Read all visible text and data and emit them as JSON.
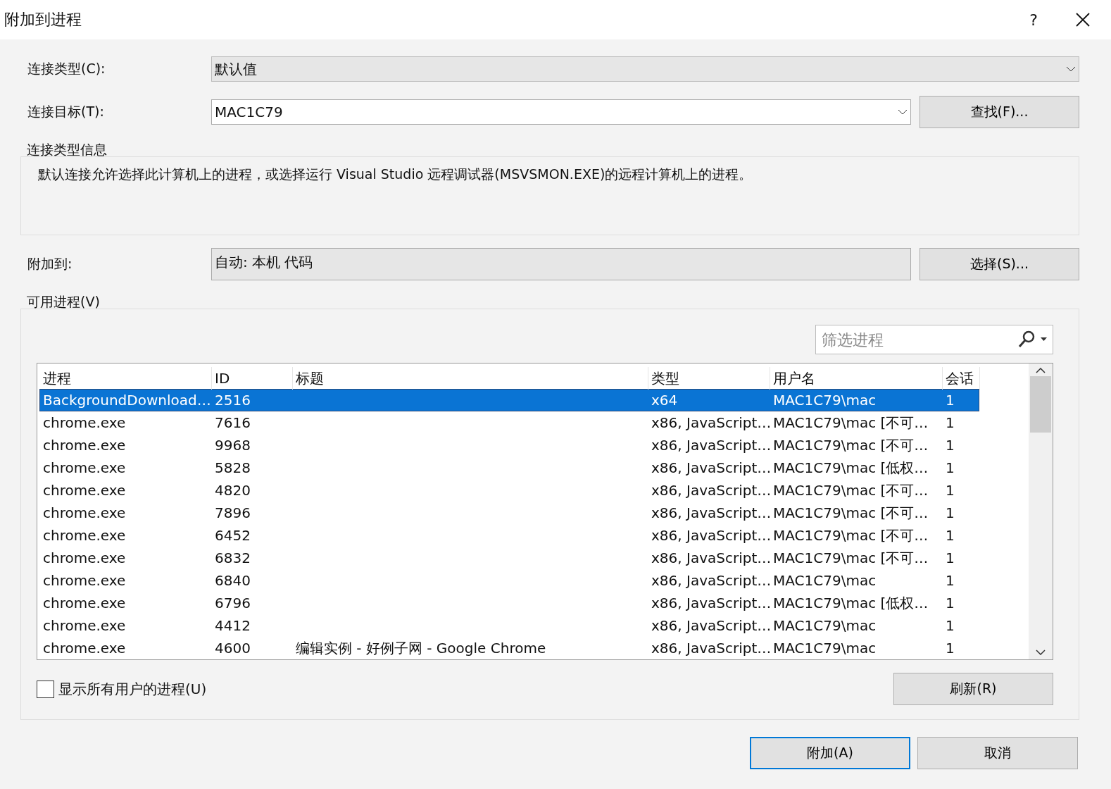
{
  "window": {
    "title": "附加到进程",
    "help": "?"
  },
  "connection_type": {
    "label": "连接类型(C):",
    "value": "默认值"
  },
  "connection_target": {
    "label": "连接目标(T):",
    "value": "MAC1C79",
    "button": "查找(F)..."
  },
  "info": {
    "heading": "连接类型信息",
    "text": "默认连接允许选择此计算机上的进程，或选择运行 Visual Studio 远程调试器(MSVSMON.EXE)的远程计算机上的进程。"
  },
  "attach_to": {
    "label": "附加到:",
    "value": "自动: 本机 代码",
    "button": "选择(S)..."
  },
  "processes": {
    "heading": "可用进程(V)",
    "filter": {
      "placeholder": "筛选进程"
    },
    "columns": [
      "进程",
      "ID",
      "标题",
      "类型",
      "用户名",
      "会话"
    ],
    "rows": [
      {
        "cells": [
          "BackgroundDownload…",
          "2516",
          "",
          "x64",
          "MAC1C79\\mac",
          "1"
        ],
        "selected": true
      },
      {
        "cells": [
          "chrome.exe",
          "7616",
          "",
          "x86, JavaScript…",
          "MAC1C79\\mac [不可…",
          "1"
        ],
        "selected": false
      },
      {
        "cells": [
          "chrome.exe",
          "9968",
          "",
          "x86, JavaScript…",
          "MAC1C79\\mac [不可…",
          "1"
        ],
        "selected": false
      },
      {
        "cells": [
          "chrome.exe",
          "5828",
          "",
          "x86, JavaScript…",
          "MAC1C79\\mac [低权…",
          "1"
        ],
        "selected": false
      },
      {
        "cells": [
          "chrome.exe",
          "4820",
          "",
          "x86, JavaScript…",
          "MAC1C79\\mac [不可…",
          "1"
        ],
        "selected": false
      },
      {
        "cells": [
          "chrome.exe",
          "7896",
          "",
          "x86, JavaScript…",
          "MAC1C79\\mac [不可…",
          "1"
        ],
        "selected": false
      },
      {
        "cells": [
          "chrome.exe",
          "6452",
          "",
          "x86, JavaScript…",
          "MAC1C79\\mac [不可…",
          "1"
        ],
        "selected": false
      },
      {
        "cells": [
          "chrome.exe",
          "6832",
          "",
          "x86, JavaScript…",
          "MAC1C79\\mac [不可…",
          "1"
        ],
        "selected": false
      },
      {
        "cells": [
          "chrome.exe",
          "6840",
          "",
          "x86, JavaScript…",
          "MAC1C79\\mac",
          "1"
        ],
        "selected": false
      },
      {
        "cells": [
          "chrome.exe",
          "6796",
          "",
          "x86, JavaScript…",
          "MAC1C79\\mac [低权…",
          "1"
        ],
        "selected": false
      },
      {
        "cells": [
          "chrome.exe",
          "4412",
          "",
          "x86, JavaScript…",
          "MAC1C79\\mac",
          "1"
        ],
        "selected": false
      },
      {
        "cells": [
          "chrome.exe",
          "4600",
          "编辑实例 - 好例子网 - Google Chrome",
          "x86, JavaScript…",
          "MAC1C79\\mac",
          "1"
        ],
        "selected": false
      }
    ],
    "show_all": {
      "label": "显示所有用户的进程(U)",
      "checked": false
    },
    "refresh": "刷新(R)"
  },
  "buttons": [
    {
      "label": "附加(A)",
      "default": true
    },
    {
      "label": "取消",
      "default": false
    }
  ]
}
